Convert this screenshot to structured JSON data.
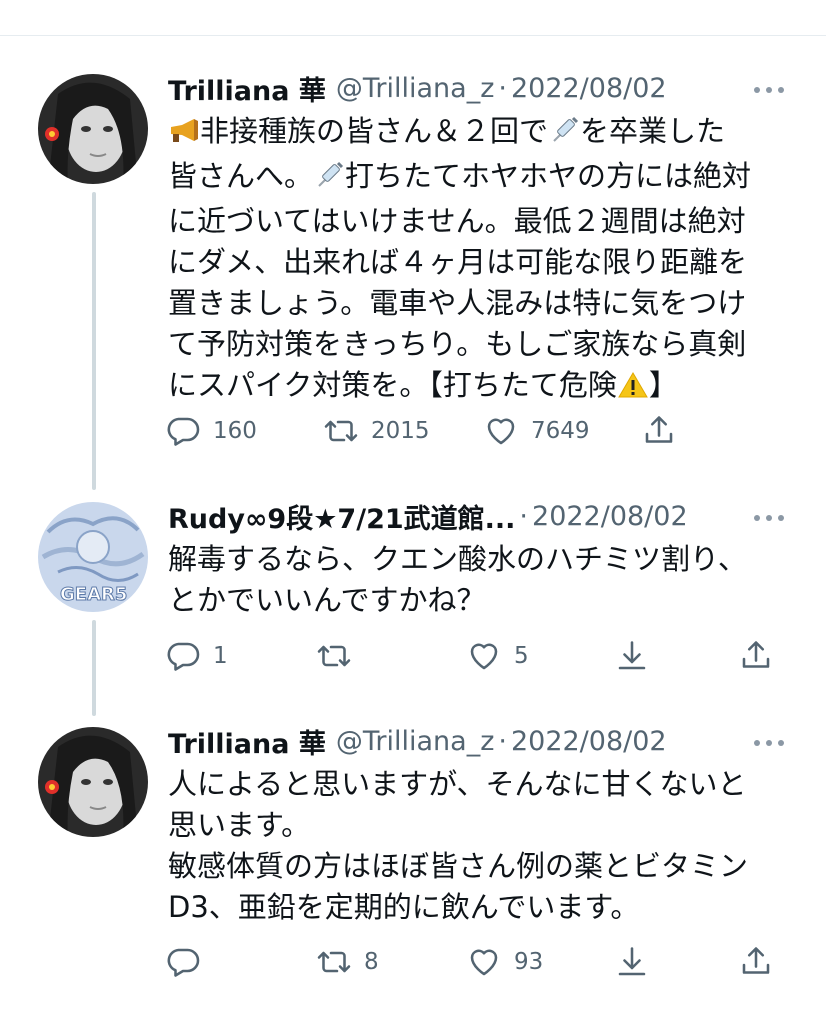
{
  "tweets": [
    {
      "name": "Trilliana 華",
      "handle": "@Trilliana_z",
      "separator": "·",
      "date": "2022/08/02",
      "lines": [
        "非接種族の皆さん＆２回で",
        "を卒業した",
        "皆さんへ。",
        "打ちたてホヤホヤの方には絶対",
        "に近づいてはいけません。最低２週間は絶対",
        "にダメ、出来れば４ヶ月は可能な限り距離を",
        "置きましょう。電車や人混みは特に気をつけ",
        "て予防対策をきっちり。もしご家族なら真剣",
        "にスパイク対策を。【打ちたて危険",
        "】"
      ],
      "reply_count": "160",
      "retweet_count": "2015",
      "like_count": "7649"
    },
    {
      "name": "Rudy∞9段★7/21武道館...",
      "separator": "·",
      "date": "2022/08/02",
      "lines": [
        "解毒するなら、クエン酸水のハチミツ割り、",
        "とかでいいんですかね？"
      ],
      "reply_count": "1",
      "retweet_count": "",
      "like_count": "5"
    },
    {
      "name": "Trilliana 華",
      "handle": "@Trilliana_z",
      "separator": "·",
      "date": "2022/08/02",
      "lines": [
        "人によると思いますが、そんなに甘くないと",
        "思います。",
        "敏感体質の方はほぼ皆さん例の薬とビタミン",
        "D3、亜鉛を定期的に飲んでいます。"
      ],
      "reply_count": "",
      "retweet_count": "8",
      "like_count": "93"
    }
  ],
  "icons": [
    "reply-icon",
    "retweet-icon",
    "like-icon",
    "share-icon",
    "download-icon",
    "more-icon",
    "megaphone-icon",
    "syringe-icon",
    "warning-icon"
  ],
  "colors": {
    "text": "#0f1419",
    "secondary": "#536471",
    "thread": "#cfd9de",
    "divider": "#e6ecf0"
  }
}
